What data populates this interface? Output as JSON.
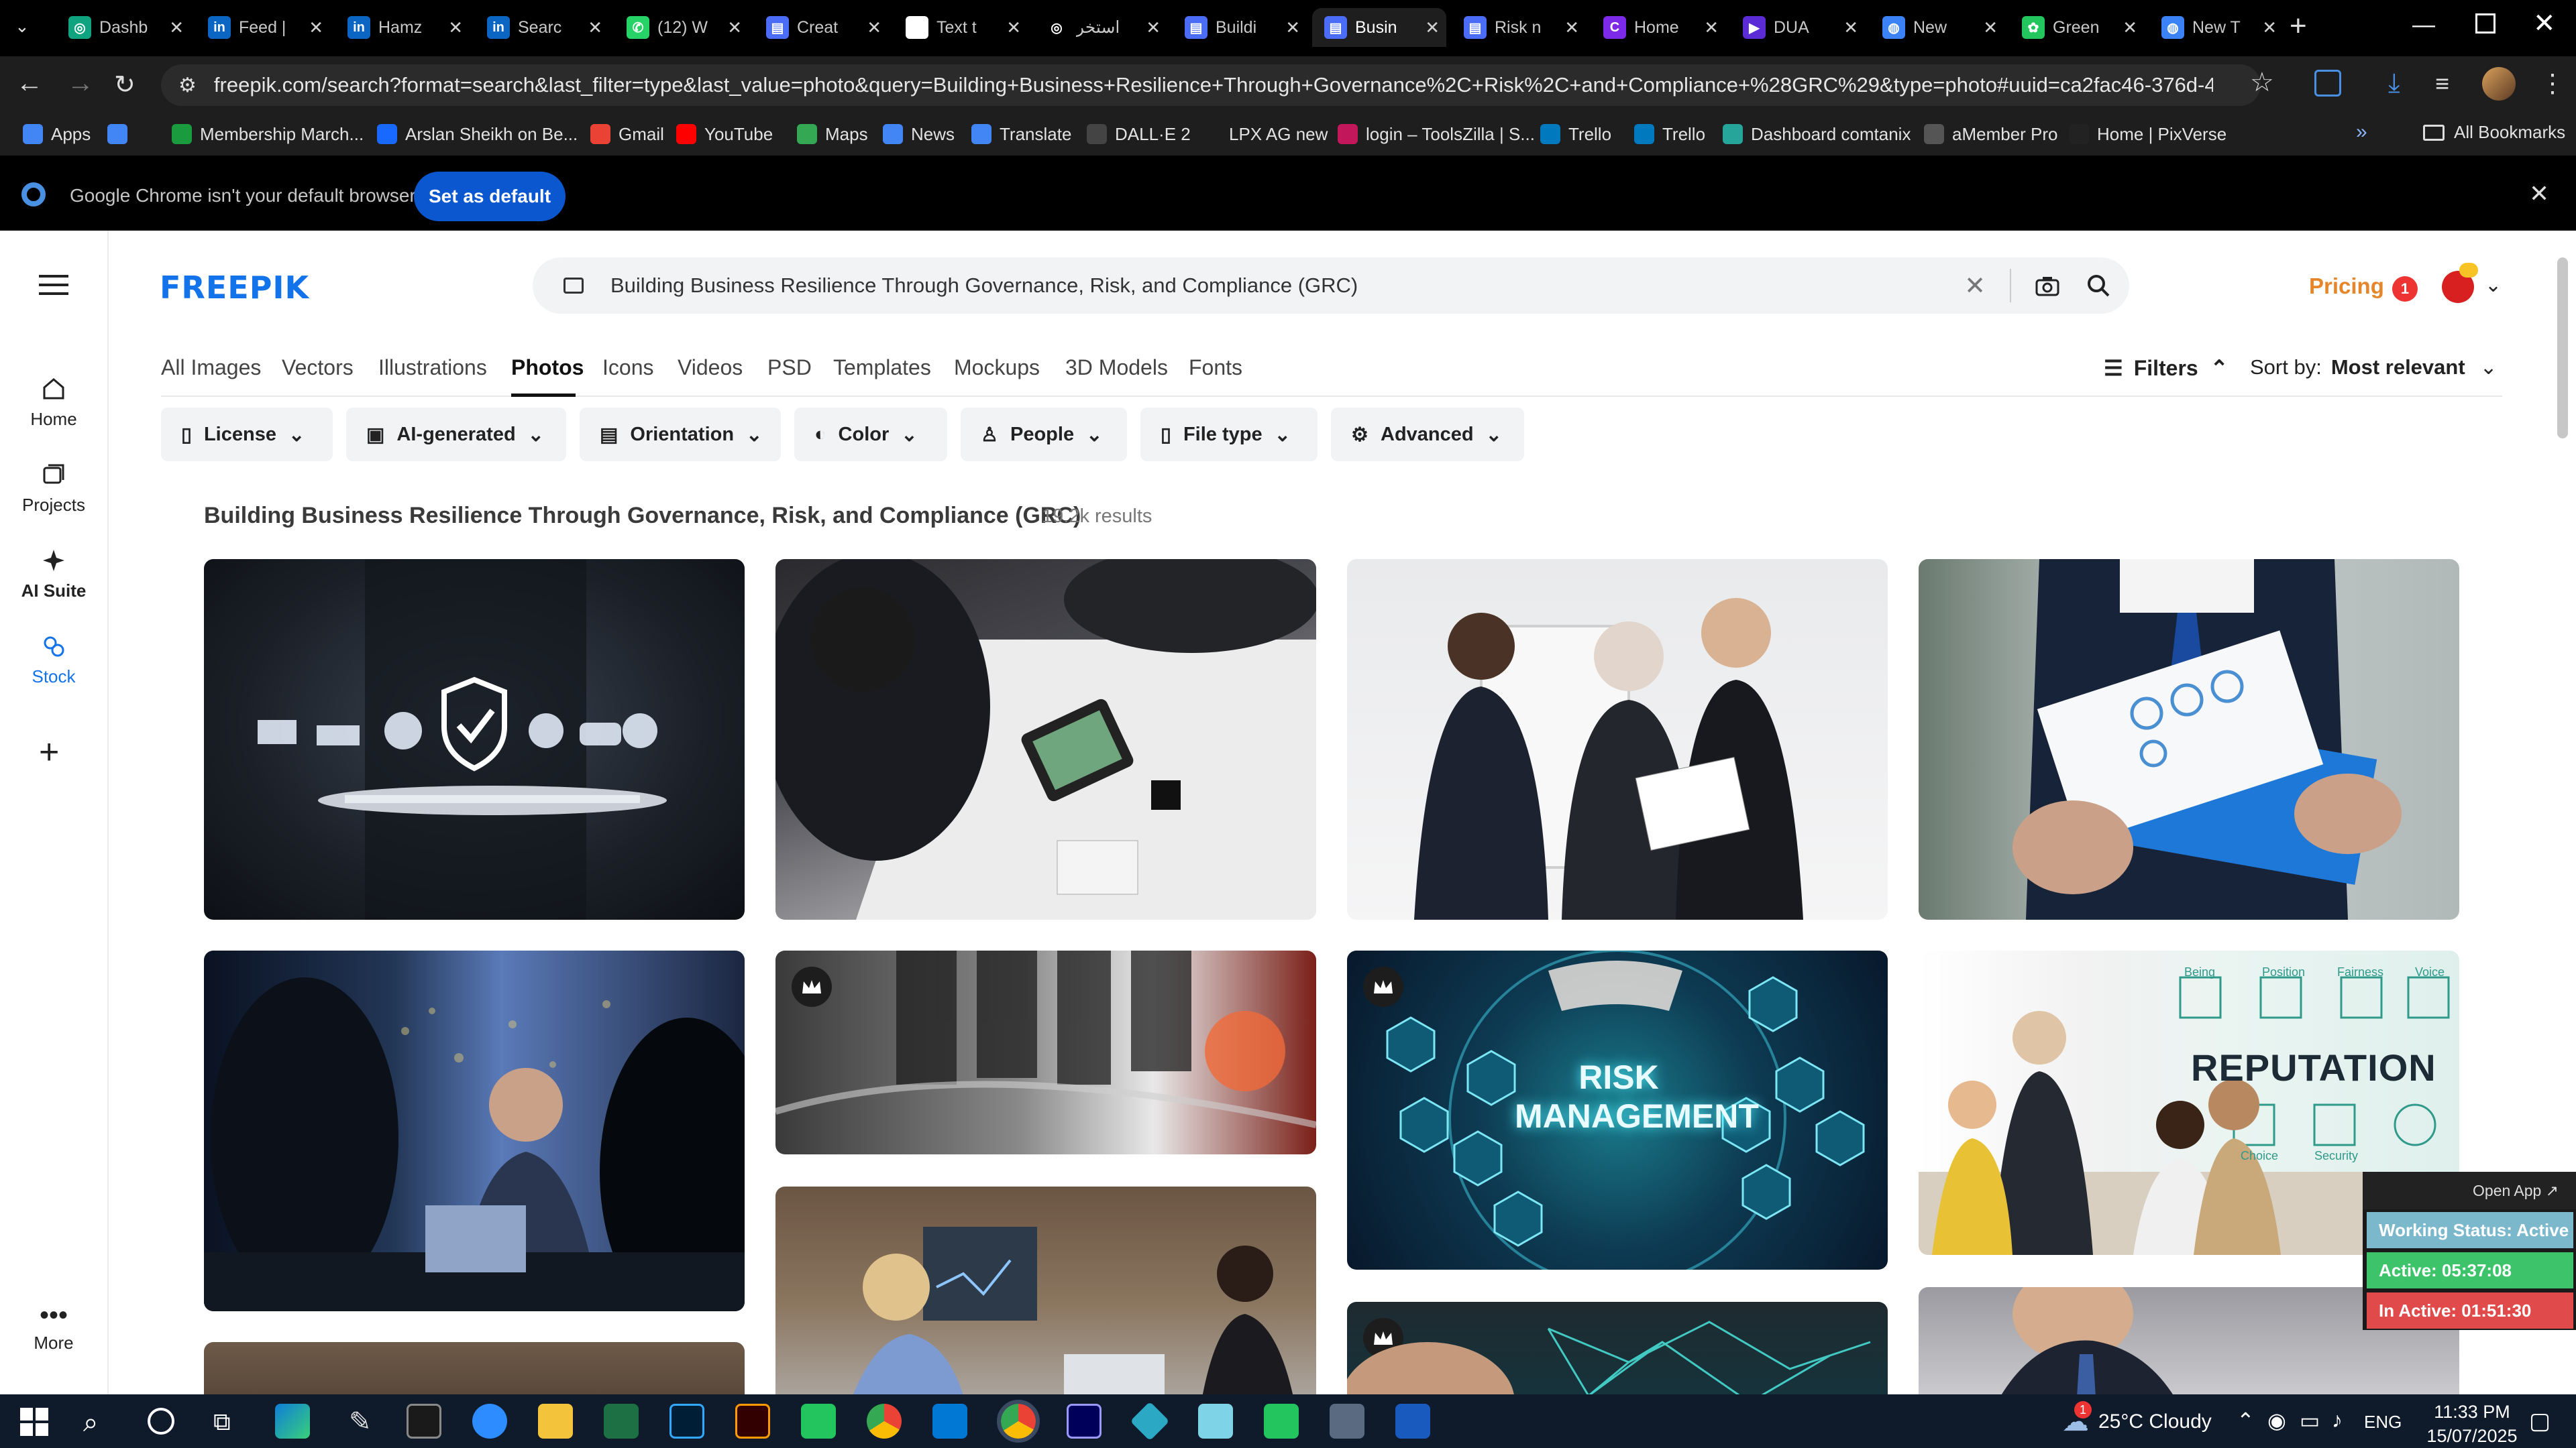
{
  "browser": {
    "tabs": [
      {
        "label": "Dashb",
        "icon": "openai-icon",
        "color": "#10a37f",
        "glyph": "◎"
      },
      {
        "label": "Feed |",
        "icon": "linkedin-icon",
        "color": "#0a66c2",
        "glyph": "in"
      },
      {
        "label": "Hamz",
        "icon": "linkedin-icon",
        "color": "#0a66c2",
        "glyph": "in"
      },
      {
        "label": "Searc",
        "icon": "linkedin-icon",
        "color": "#0a66c2",
        "glyph": "in"
      },
      {
        "label": "(12) W",
        "icon": "whatsapp-icon",
        "color": "#25d366",
        "glyph": "✆"
      },
      {
        "label": "Creat",
        "icon": "form-icon",
        "color": "#4a6cf7",
        "glyph": "▤"
      },
      {
        "label": "Text t",
        "icon": "text-icon",
        "color": "#ffffff",
        "glyph": "❚❚"
      },
      {
        "label": "استخر",
        "icon": "chatgpt-icon",
        "color": "#000000",
        "glyph": "◎"
      },
      {
        "label": "Buildi",
        "icon": "form-icon",
        "color": "#4a6cf7",
        "glyph": "▤"
      },
      {
        "label": "Busin",
        "icon": "form-icon",
        "color": "#4a6cf7",
        "glyph": "▤"
      },
      {
        "label": "Risk n",
        "icon": "form-icon",
        "color": "#4a6cf7",
        "glyph": "▤"
      },
      {
        "label": "Home",
        "icon": "canva-icon",
        "color": "#7d2ae8",
        "glyph": "C"
      },
      {
        "label": "DUA",
        "icon": "video-icon",
        "color": "#5b2bd6",
        "glyph": "▶"
      },
      {
        "label": "New",
        "icon": "globe-icon",
        "color": "#3b82f6",
        "glyph": "◍"
      },
      {
        "label": "Green",
        "icon": "palm-icon",
        "color": "#22c55e",
        "glyph": "✿"
      },
      {
        "label": "New T",
        "icon": "globe-icon",
        "color": "#3b82f6",
        "glyph": "◍"
      }
    ],
    "url": "freepik.com/search?format=search&last_filter=type&last_value=photo&query=Building+Business+Resilience+Through+Governance%2C+Risk%2C+and+Compliance+%28GRC%29&type=photo#uuid=ca2fac46-376d-4ca8-8abf-f91f3712acd7",
    "bookmarks": [
      {
        "label": "Apps",
        "color": "#4285f4"
      },
      {
        "label": "",
        "color": "#4285f4"
      },
      {
        "label": "Membership March...",
        "color": "#1a9c3e"
      },
      {
        "label": "Arslan Sheikh on Be...",
        "color": "#1769ff"
      },
      {
        "label": "Gmail",
        "color": "#ea4335"
      },
      {
        "label": "YouTube",
        "color": "#ff0000"
      },
      {
        "label": "Maps",
        "color": "#34a853"
      },
      {
        "label": "News",
        "color": "#4285f4"
      },
      {
        "label": "Translate",
        "color": "#4285f4"
      },
      {
        "label": "DALL·E 2",
        "color": "#444444"
      },
      {
        "label": "LPX AG new",
        "color": "#1e1e1e"
      },
      {
        "label": "login – ToolsZilla | S...",
        "color": "#c2185b"
      },
      {
        "label": "Trello",
        "color": "#0079bf"
      },
      {
        "label": "Trello",
        "color": "#0079bf"
      },
      {
        "label": "Dashboard comtanix",
        "color": "#26a69a"
      },
      {
        "label": "aMember Pro",
        "color": "#555555"
      },
      {
        "label": "Home | PixVerse",
        "color": "#222222"
      }
    ],
    "all_bookmarks": "All Bookmarks",
    "infobar_text": "Google Chrome isn't your default browser",
    "set_default_label": "Set as default"
  },
  "freepik": {
    "logo": "FREEPIK",
    "sidebar": [
      {
        "label": "Home",
        "icon": "home-icon"
      },
      {
        "label": "Projects",
        "icon": "projects-icon"
      },
      {
        "label": "AI Suite",
        "icon": "ai-suite-icon"
      },
      {
        "label": "Stock",
        "icon": "stock-icon"
      }
    ],
    "more_label": "More",
    "search_value": "Building Business Resilience Through Governance, Risk, and Compliance (GRC)",
    "pricing": "Pricing",
    "notification_count": "1",
    "categories": [
      "All Images",
      "Vectors",
      "Illustrations",
      "Photos",
      "Icons",
      "Videos",
      "PSD",
      "Templates",
      "Mockups",
      "3D Models",
      "Fonts"
    ],
    "active_category": "Photos",
    "filters_label": "Filters",
    "sort_label": "Sort by:",
    "sort_value": "Most relevant",
    "filter_buttons": [
      "License",
      "AI-generated",
      "Orientation",
      "Color",
      "People",
      "File type",
      "Advanced"
    ],
    "result_title": "Building Business Resilience Through Governance, Risk, and Compliance (GRC)",
    "result_count": "19.2k results",
    "image_texts": {
      "risk": "RISK MANAGEMENT",
      "reputation": "REPUTATION",
      "rep_small": [
        "Being",
        "Position",
        "Fairness",
        "Voice",
        "Choice",
        "Security"
      ]
    }
  },
  "tracker": {
    "open_app": "Open App ↗",
    "status": "Working Status: Active",
    "active": "Active: 05:37:08",
    "inactive": "In Active: 01:51:30"
  },
  "taskbar": {
    "weather": "25°C  Cloudy",
    "weather_badge": "1",
    "language": "ENG",
    "time": "11:33 PM",
    "date": "15/07/2025"
  }
}
